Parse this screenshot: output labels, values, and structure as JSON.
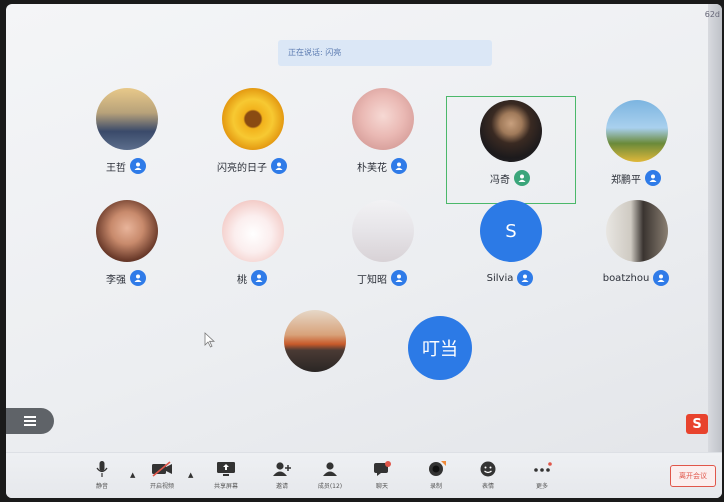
{
  "status": {
    "speaking_text": "正在说话: 闪亮",
    "corner_text": "62d"
  },
  "participants": [
    {
      "name": "王哲"
    },
    {
      "name": "闪亮的日子"
    },
    {
      "name": "朴芙花"
    },
    {
      "name": "冯奇"
    },
    {
      "name": "郑鹏平"
    },
    {
      "name": "李强"
    },
    {
      "name": "桃"
    },
    {
      "name": "丁知昭"
    },
    {
      "name": "Silvia",
      "initial": "S"
    },
    {
      "name": "boatzhou"
    }
  ],
  "extra": {
    "dingdang_label": "叮当"
  },
  "toolbar": {
    "mic_label": "静音",
    "video_label": "开启视频",
    "share_label": "共享屏幕",
    "invite_label": "邀请",
    "members_label": "成员(12)",
    "chat_label": "聊天",
    "record_label": "录制",
    "emoji_label": "表情",
    "more_label": "更多",
    "end_label": "离开会议"
  },
  "colors": {
    "accent": "#2c7ae6",
    "highlight": "#4bb86a",
    "danger": "#e0564a"
  }
}
